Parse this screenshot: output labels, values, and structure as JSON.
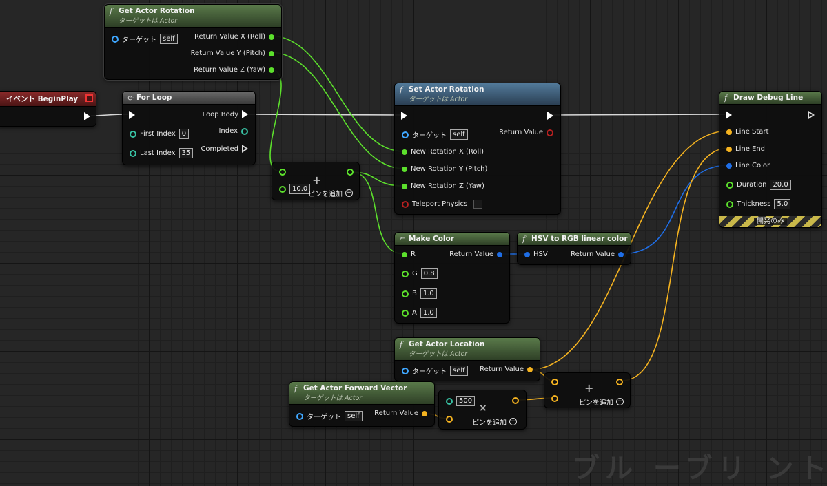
{
  "nodes": {
    "get_actor_rotation": {
      "title": "Get Actor Rotation",
      "subtitle": "ターゲットは Actor",
      "target_label": "ターゲット",
      "target_value": "self",
      "out_x": "Return Value X (Roll)",
      "out_y": "Return Value Y (Pitch)",
      "out_z": "Return Value Z (Yaw)"
    },
    "event_begin_play": {
      "title": "イベント BeginPlay"
    },
    "for_loop": {
      "title": "For Loop",
      "first_index_label": "First Index",
      "first_index_value": "0",
      "last_index_label": "Last Index",
      "last_index_value": "35",
      "loop_body": "Loop Body",
      "index": "Index",
      "completed": "Completed"
    },
    "add_node_top": {
      "input_value": "10.0",
      "add_pin": "ピンを追加"
    },
    "set_actor_rotation": {
      "title": "Set Actor Rotation",
      "subtitle": "ターゲットは Actor",
      "target_label": "ターゲット",
      "target_value": "self",
      "return_value": "Return Value",
      "new_x": "New Rotation X (Roll)",
      "new_y": "New Rotation Y (Pitch)",
      "new_z": "New Rotation Z (Yaw)",
      "teleport": "Teleport Physics"
    },
    "draw_debug_line": {
      "title": "Draw Debug Line",
      "line_start": "Line Start",
      "line_end": "Line End",
      "line_color": "Line Color",
      "duration_label": "Duration",
      "duration_value": "20.0",
      "thickness_label": "Thickness",
      "thickness_value": "5.0",
      "dev_only": "開発のみ"
    },
    "make_color": {
      "title": "Make Color",
      "r": "R",
      "g": "G",
      "g_value": "0.8",
      "b": "B",
      "b_value": "1.0",
      "a": "A",
      "a_value": "1.0",
      "return_value": "Return Value"
    },
    "hsv_to_rgb": {
      "title": "HSV to RGB linear color",
      "hsv": "HSV",
      "return_value": "Return Value"
    },
    "get_actor_location": {
      "title": "Get Actor Location",
      "subtitle": "ターゲットは Actor",
      "target_label": "ターゲット",
      "target_value": "self",
      "return_value": "Return Value"
    },
    "get_actor_forward_vector": {
      "title": "Get Actor Forward Vector",
      "subtitle": "ターゲットは Actor",
      "target_label": "ターゲット",
      "target_value": "self",
      "return_value": "Return Value"
    },
    "multiply_node": {
      "input_value": "500",
      "add_pin": "ピンを追加"
    },
    "add_vector_node": {
      "add_pin": "ピンを追加"
    }
  },
  "watermark": "ブル ーブリ ント",
  "colors": {
    "float_pin": "#5ce02c",
    "int_pin": "#38c1a3",
    "vector_pin": "#f5b320",
    "color_pin": "#1f6ee6",
    "object_pin": "#3fa7ff",
    "bool_pin": "#b52020",
    "exec_wire": "#d8d8d8"
  }
}
